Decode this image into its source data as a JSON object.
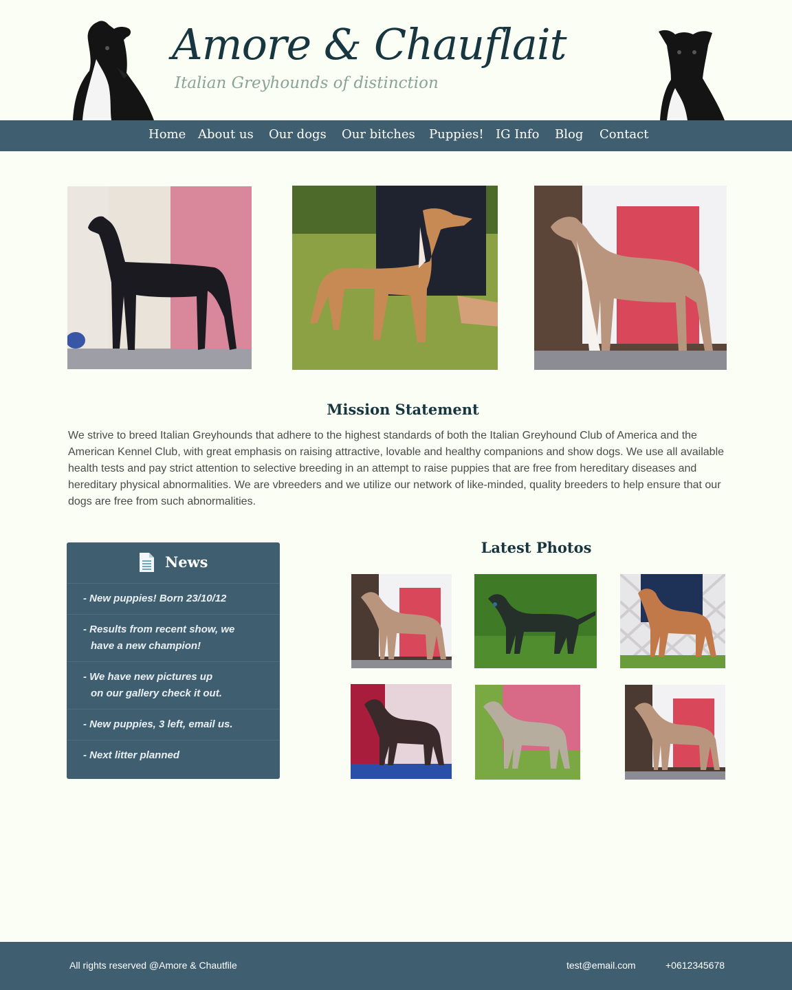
{
  "header": {
    "title": "Amore & Chauflait",
    "tagline": "Italian Greyhounds of distinction"
  },
  "nav": {
    "items": [
      "Home",
      "About us",
      "Our dogs",
      "Our bitches",
      "Puppies!",
      "IG Info",
      "Blog",
      "Contact"
    ]
  },
  "mission": {
    "title": "Mission Statement",
    "text": "We strive to breed Italian Greyhounds that adhere to the highest standards of both the Italian Greyhound Club of America and the American Kennel Club, with great emphasis  on raising attractive, lovable and healthy companions and show dogs.  We use all available health tests and pay strict attention to selective breeding in an attempt to raise puppies that are free from hereditary diseases and hereditary physical abnormalities.  We are vbreeders and we utilize our network of like-minded, quality breeders to help ensure that our dogs are free from such abnormalities."
  },
  "news": {
    "title": "News",
    "icon": "document-icon",
    "items": [
      {
        "line1": "- New puppies! Born 23/10/12",
        "line2": ""
      },
      {
        "line1": "- Results from recent show, we",
        "line2": "have a new champion!"
      },
      {
        "line1": "- We have new pictures up",
        "line2": "on our gallery check it out."
      },
      {
        "line1": "- New puppies, 3 left, email us.",
        "line2": ""
      },
      {
        "line1": "- Next litter planned",
        "line2": ""
      }
    ]
  },
  "latest_photos": {
    "title": "Latest Photos"
  },
  "footer": {
    "copyright": "All rights reserved @Amore & Chautfile",
    "email": "test@email.com",
    "phone": "+0612345678"
  },
  "colors": {
    "background": "#fbfef4",
    "nav": "#3f5f70",
    "heading": "#17363f",
    "tagline": "#8aa397"
  }
}
